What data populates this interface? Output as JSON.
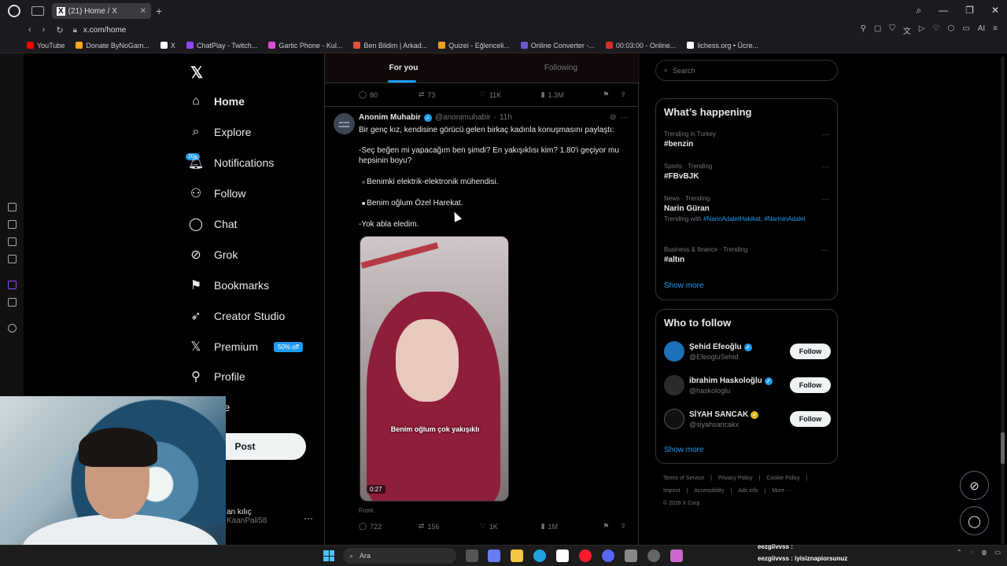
{
  "browser": {
    "tab_title": "(21) Home / X",
    "url": "x.com/home",
    "bookmarks": [
      {
        "label": "YouTube",
        "color": "#ff0000"
      },
      {
        "label": "Donate ByNoGam...",
        "color": "#f5a623"
      },
      {
        "label": "X",
        "color": "#ffffff"
      },
      {
        "label": "ChatPlay - Twitch...",
        "color": "#9146ff"
      },
      {
        "label": "Gartic Phone - Kul...",
        "color": "#d84fd8"
      },
      {
        "label": "Ben Bildim | Arkad...",
        "color": "#e0503a"
      },
      {
        "label": "Quizei - Eğlenceli...",
        "color": "#f0a020"
      },
      {
        "label": "Online Converter -...",
        "color": "#6a5acd"
      },
      {
        "label": "00:03:00 - Online...",
        "color": "#d0312d"
      },
      {
        "label": "lichess.org • Ücre...",
        "color": "#ffffff"
      }
    ]
  },
  "nav": {
    "items": [
      {
        "label": "Home",
        "icon": "home-icon"
      },
      {
        "label": "Explore",
        "icon": "search-icon"
      },
      {
        "label": "Notifications",
        "icon": "bell-icon"
      },
      {
        "label": "Follow",
        "icon": "person-add-icon"
      },
      {
        "label": "Chat",
        "icon": "chat-icon"
      },
      {
        "label": "Grok",
        "icon": "grok-icon"
      },
      {
        "label": "Bookmarks",
        "icon": "bookmark-icon"
      },
      {
        "label": "Creator Studio",
        "icon": "rocket-icon"
      },
      {
        "label": "Premium",
        "icon": "x-icon"
      },
      {
        "label": "Profile",
        "icon": "person-icon"
      },
      {
        "label": "ore",
        "icon": "more-icon"
      }
    ],
    "notif_badge": "20+",
    "premium_badge": "50% off",
    "post_button": "Post",
    "profile_name": "an kılıç",
    "profile_handle": "KaanPali58"
  },
  "feed": {
    "tabs": [
      "For you",
      "Following"
    ],
    "prev_tweet_stats": {
      "replies": "80",
      "reposts": "73",
      "likes": "11K",
      "views": "1.3M"
    },
    "tweet": {
      "author": "Anonim Muhabir",
      "handle": "@anonimuhabir",
      "time": "11h",
      "avatar_text": "anonim muhabir",
      "line1": "Bir genç kız, kendisine görücü gelen birkaç kadınla konuşmasını paylaştı:",
      "line2": "-Seç beğen mi yapacağım ben şimdi? En yakışıklısı kim? 1.80'i geçiyor mu hepsinin boyu?",
      "bullet1": "Benimki elektrik-elektronik mühendisi.",
      "bullet2": "Benim oğlum Özel Harekat.",
      "line3": "-Yok abla eledim.",
      "video_caption": "Benim oğlum çok yakışıklı",
      "video_duration": "0:27",
      "from_label": "From",
      "stats": {
        "replies": "722",
        "reposts": "156",
        "likes": "1K",
        "views": "1M"
      }
    }
  },
  "sidebar": {
    "search_placeholder": "Search",
    "happening_title": "What’s happening",
    "trends": [
      {
        "context": "Trending in Turkey",
        "name": "#benzin",
        "with": ""
      },
      {
        "context": "Sports · Trending",
        "name": "#FBvBJK",
        "with": ""
      },
      {
        "context": "News · Trending",
        "name": "Narin Güran",
        "with_prefix": "Trending with",
        "with": "#NarinAdaletHakikat, #NarininAdalet"
      },
      {
        "context": "Business & finance · Trending",
        "name": "#altın",
        "with": ""
      }
    ],
    "show_more": "Show more",
    "wtf_title": "Who to follow",
    "who_to_follow": [
      {
        "name": "Şehid Efeoğlu",
        "handle": "@EfeogluSehid",
        "button": "Follow",
        "badge": "blue"
      },
      {
        "name": "ibrahim Haskoloğlu",
        "handle": "@haskologlu",
        "button": "Follow",
        "badge": "blue"
      },
      {
        "name": "SİYAH SANCAK",
        "handle": "@siyahsancakx",
        "button": "Follow",
        "badge": "gold"
      }
    ],
    "footer": {
      "row1": [
        "Terms of Service",
        "Privacy Policy",
        "Cookie Policy"
      ],
      "row2": [
        "Imprint",
        "Accessibility",
        "Ads info",
        "More ···"
      ],
      "copyright": "© 2026 X Corp."
    }
  },
  "taskbar": {
    "search_placeholder": "Ara",
    "chat_line1": "eezgiivvss :",
    "chat_line2": "eezgiivvss : iyisiznapiorsunuz"
  },
  "colors": {
    "accent": "#1d9bf0",
    "background": "#000000"
  }
}
